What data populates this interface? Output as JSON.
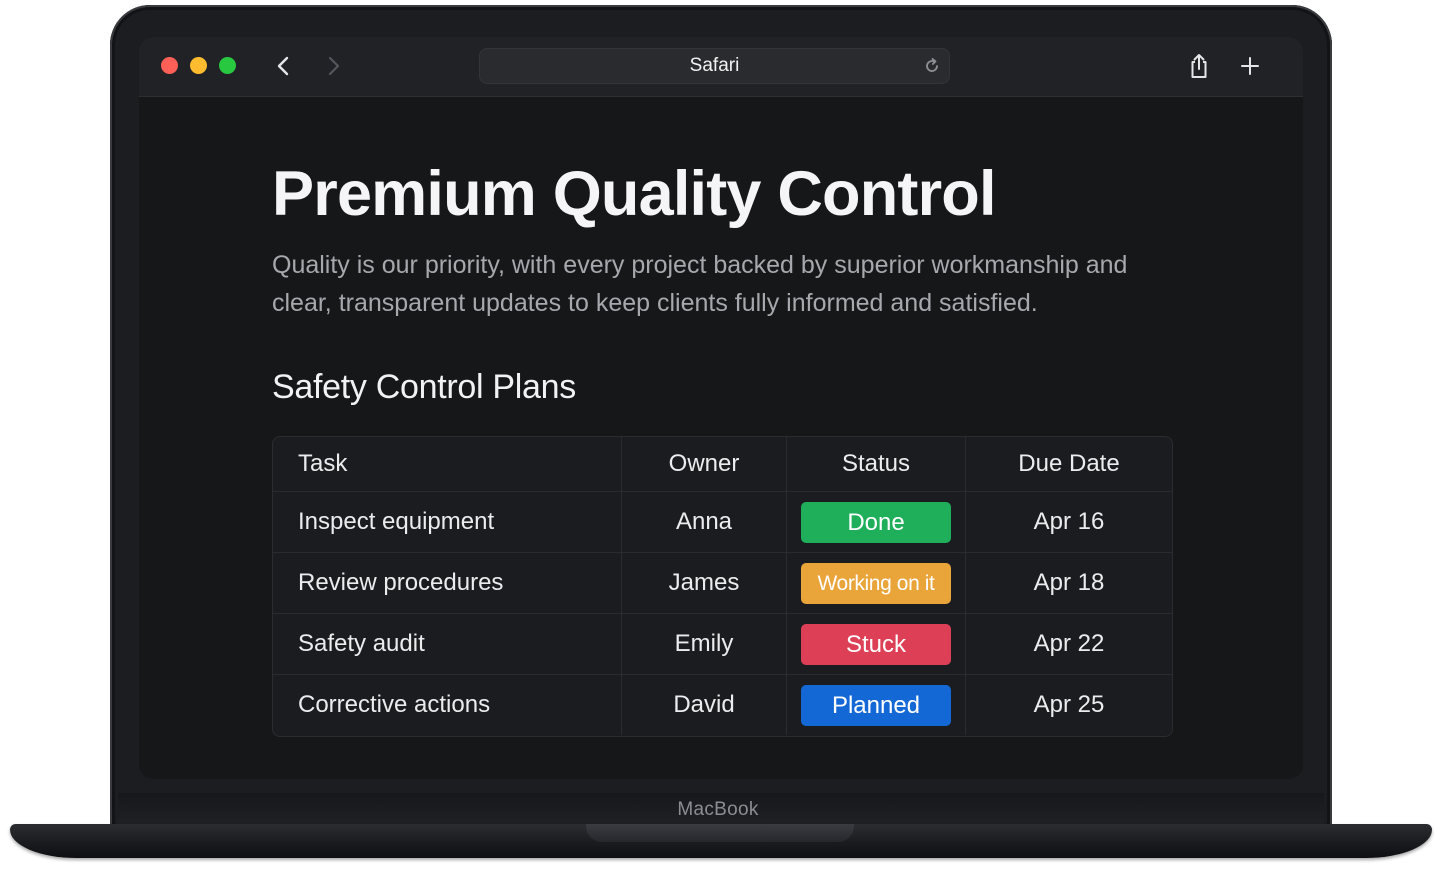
{
  "device": {
    "brand_label": "MacBook"
  },
  "browser": {
    "address_text": "Safari",
    "icons": {
      "back": "chevron-left-icon",
      "forward": "chevron-right-icon",
      "reload": "reload-icon",
      "share": "share-icon",
      "new_tab": "plus-icon"
    }
  },
  "page": {
    "title": "Premium Quality Control",
    "description": "Quality is our priority, with every project backed by superior workmanship and clear, transparent updates to keep clients fully informed and satisfied.",
    "section_title": "Safety Control Plans",
    "table": {
      "headers": [
        "Task",
        "Owner",
        "Status",
        "Due Date"
      ],
      "rows": [
        {
          "task": "Inspect equipment",
          "owner": "Anna",
          "status": "Done",
          "status_color": "#1faf5a",
          "due": "Apr 16"
        },
        {
          "task": "Review procedures",
          "owner": "James",
          "status": "Working on it",
          "status_color": "#e9a43a",
          "due": "Apr 18"
        },
        {
          "task": "Safety audit",
          "owner": "Emily",
          "status": "Stuck",
          "status_color": "#dd3f57",
          "due": "Apr 22"
        },
        {
          "task": "Corrective actions",
          "owner": "David",
          "status": "Planned",
          "status_color": "#1468d6",
          "due": "Apr 25"
        }
      ]
    }
  },
  "colors": {
    "screen_bg": "#161719",
    "toolbar_bg": "#212225",
    "title_text": "#f5f5f7",
    "muted_text": "#a6a8ad"
  }
}
